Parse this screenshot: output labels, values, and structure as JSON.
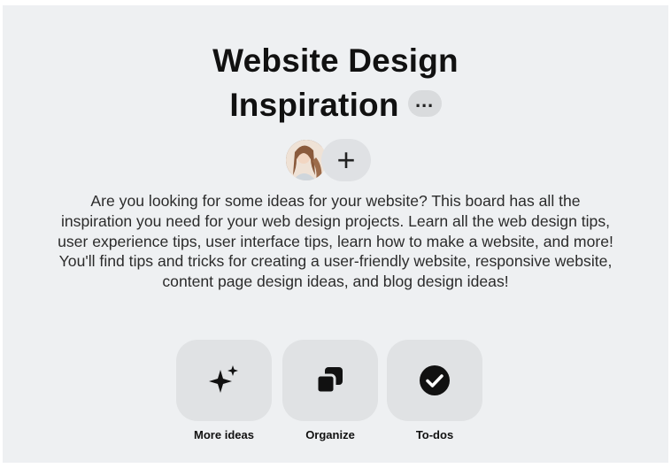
{
  "board": {
    "title_line1": "Website Design",
    "title_line2": "Inspiration",
    "more_label": "…",
    "add_collaborator_label": "+",
    "description": "Are you looking for some ideas for your website? This board has all the inspiration you need for your web design projects. Learn all the web design tips, user experience tips, user interface tips, learn how to make a website, and more! You'll find tips and tricks for creating a user-friendly website, responsive website, content page design ideas, and blog design ideas!"
  },
  "actions": [
    {
      "label": "More ideas",
      "icon": "sparkle-icon"
    },
    {
      "label": "Organize",
      "icon": "organize-icon"
    },
    {
      "label": "To-dos",
      "icon": "checkmark-circle-icon"
    }
  ],
  "colors": {
    "page_bg": "#eef0f2",
    "tile_bg": "#e0e2e4",
    "text": "#111111"
  }
}
